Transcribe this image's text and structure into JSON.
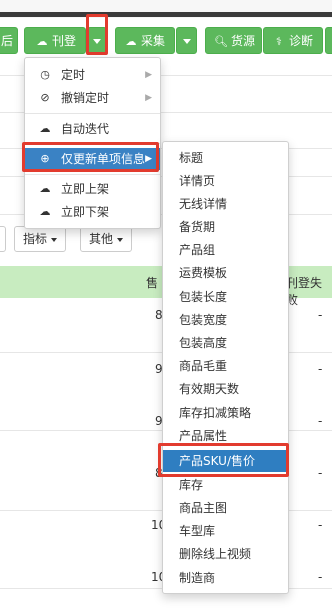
{
  "toolbar": {
    "cut_left_label": "后",
    "publish_label": "刊登",
    "collect_label": "采集",
    "source_label": "货源",
    "diagnose_label": "诊断"
  },
  "filters": {
    "metrics_label": "指标",
    "other_label": "其他"
  },
  "table": {
    "col_sales": "售",
    "col_publish_fail": "刊登失败",
    "rows": [
      {
        "sales": "8",
        "fail": "-"
      },
      {
        "sales": "9",
        "fail": "-"
      },
      {
        "sales": "9",
        "fail": "-"
      },
      {
        "sales": "8",
        "fail": "-"
      },
      {
        "sales": "10",
        "fail": "-"
      },
      {
        "sales": "10",
        "fail": "-"
      }
    ]
  },
  "menu_publish": {
    "items": [
      {
        "label": "定时",
        "icon": "clock-icon",
        "has_submenu": true
      },
      {
        "label": "撤销定时",
        "icon": "ban-icon",
        "has_submenu": true
      },
      {
        "label": "自动迭代",
        "icon": "cloud-upload-icon",
        "has_submenu": false
      },
      {
        "label": "仅更新单项信息",
        "icon": "plus-circle-icon",
        "has_submenu": true
      },
      {
        "label": "立即上架",
        "icon": "cloud-upload-icon",
        "has_submenu": false
      },
      {
        "label": "立即下架",
        "icon": "cloud-download-icon",
        "has_submenu": false
      }
    ]
  },
  "menu_update_single": {
    "items": [
      "标题",
      "详情页",
      "无线详情",
      "备货期",
      "产品组",
      "运费模板",
      "包装长度",
      "包装宽度",
      "包装高度",
      "商品毛重",
      "有效期天数",
      "库存扣减策略",
      "产品属性",
      "产品SKU/售价",
      "库存",
      "商品主图",
      "车型库",
      "删除线上视频",
      "制造商"
    ],
    "selected": "产品SKU/售价"
  }
}
